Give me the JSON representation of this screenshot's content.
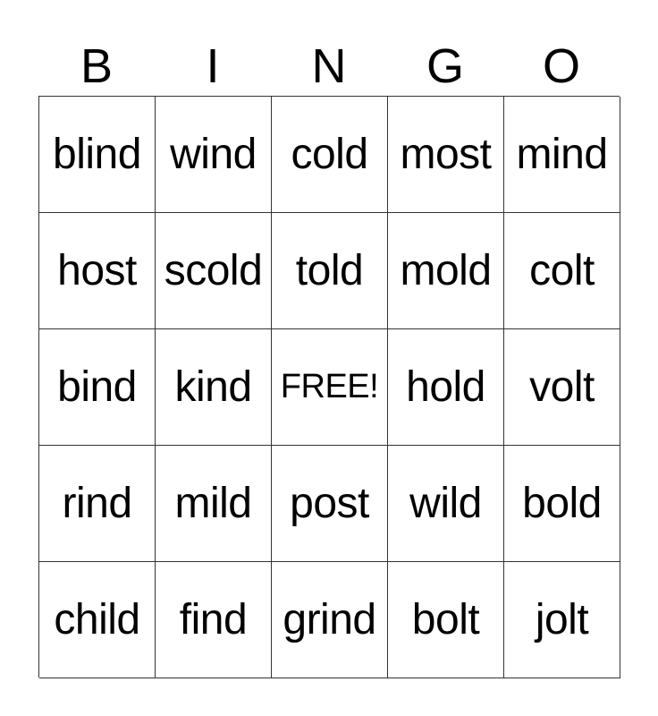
{
  "header": {
    "letters": [
      "B",
      "I",
      "N",
      "G",
      "O"
    ]
  },
  "grid": {
    "rows": [
      [
        "blind",
        "wind",
        "cold",
        "most",
        "mind"
      ],
      [
        "host",
        "scold",
        "told",
        "mold",
        "colt"
      ],
      [
        "bind",
        "kind",
        "FREE!",
        "hold",
        "volt"
      ],
      [
        "rind",
        "mild",
        "post",
        "wild",
        "bold"
      ],
      [
        "child",
        "find",
        "grind",
        "bolt",
        "jolt"
      ]
    ]
  }
}
